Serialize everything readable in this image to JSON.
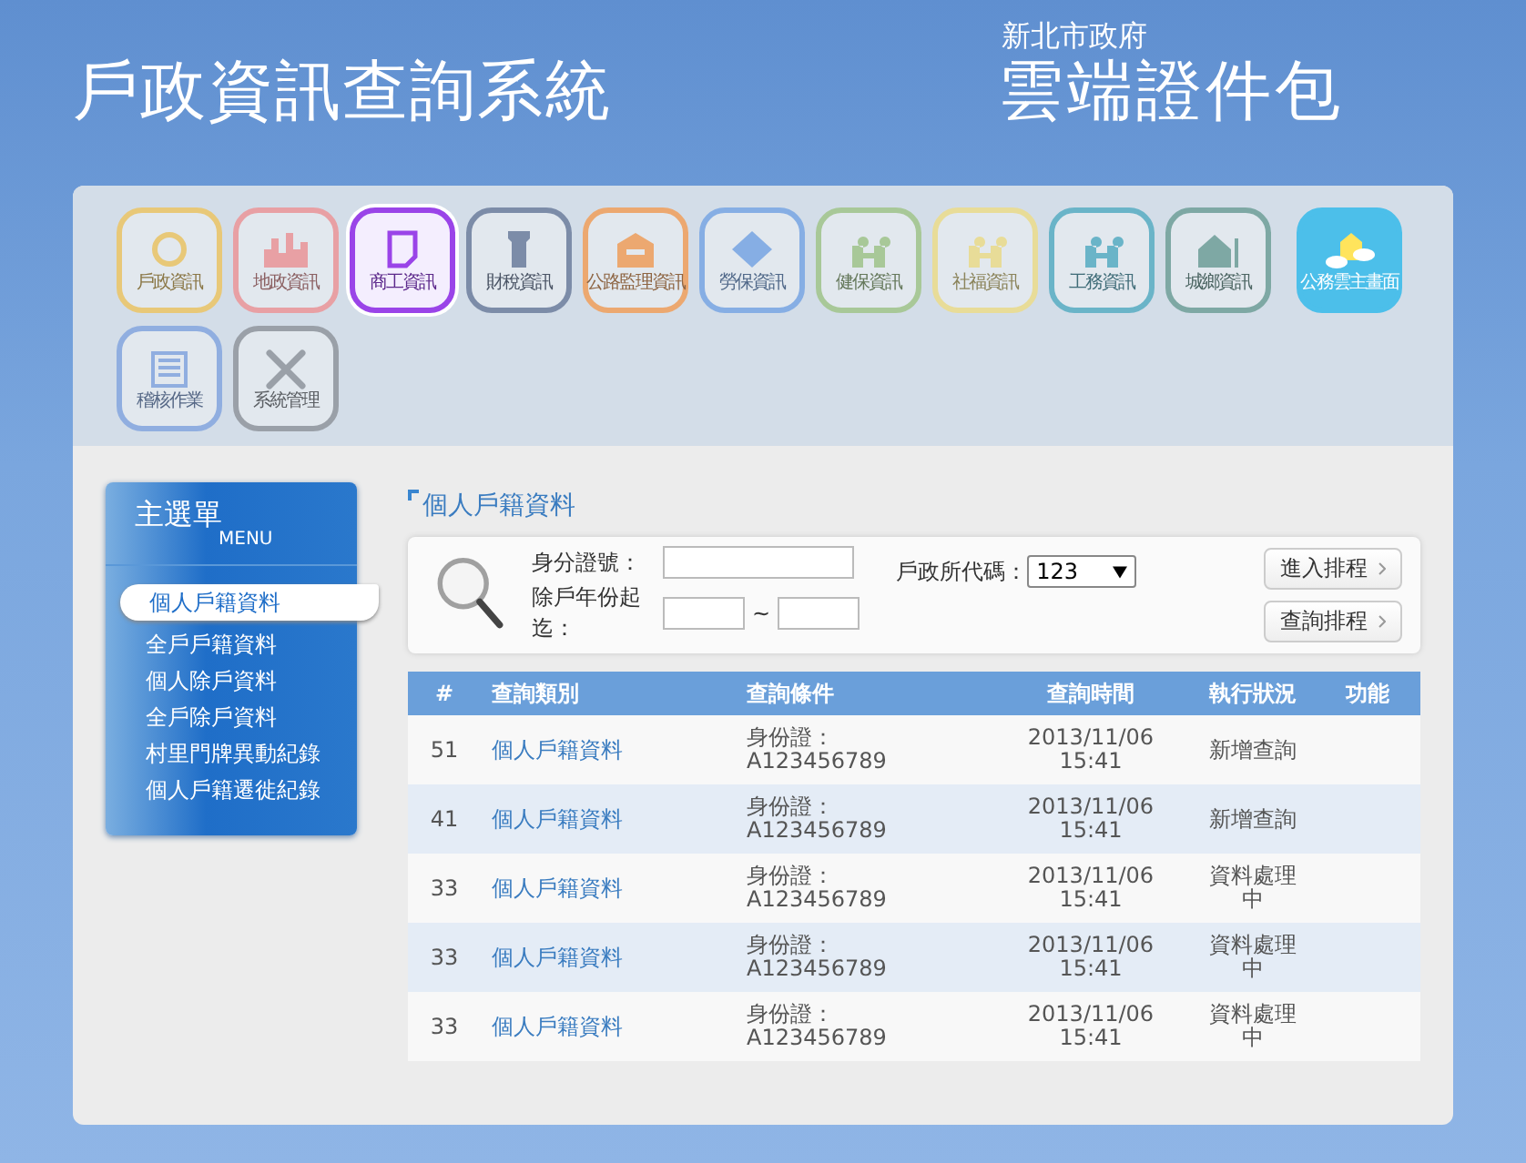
{
  "header": {
    "title": "戶政資訊查詢系統",
    "org": "新北市政府",
    "brand": "雲端證件包"
  },
  "modules": [
    {
      "kind": "module",
      "label": "戶政資訊",
      "color": "#e8c878",
      "selected": false
    },
    {
      "kind": "module",
      "label": "地政資訊",
      "color": "#e8a0a4",
      "selected": false
    },
    {
      "kind": "module",
      "label": "商工資訊",
      "color": "#9a44e8",
      "selected": true
    },
    {
      "kind": "module",
      "label": "財稅資訊",
      "color": "#7c8ca8",
      "selected": false
    },
    {
      "kind": "module",
      "label": "公路監理資訊",
      "color": "#eca870",
      "selected": false
    },
    {
      "kind": "module",
      "label": "勞保資訊",
      "color": "#86aee4",
      "selected": false
    },
    {
      "kind": "module",
      "label": "健保資訊",
      "color": "#a8c898",
      "selected": false
    },
    {
      "kind": "module",
      "label": "社福資訊",
      "color": "#e8dc98",
      "selected": false
    },
    {
      "kind": "module",
      "label": "工務資訊",
      "color": "#6ab4c8",
      "selected": false
    },
    {
      "kind": "module",
      "label": "城鄉資訊",
      "color": "#7ea8a4",
      "selected": false
    },
    {
      "kind": "home",
      "label": "公務雲主畫面",
      "color": "#4cbfea",
      "selected": false
    },
    {
      "kind": "module",
      "label": "稽核作業",
      "color": "#90aee0",
      "selected": false
    },
    {
      "kind": "module",
      "label": "系統管理",
      "color": "#9aa0a8",
      "selected": false
    }
  ],
  "sidebar": {
    "title": "主選單",
    "subtitle": "MENU",
    "items": [
      {
        "label": "個人戶籍資料",
        "selected": true
      },
      {
        "label": "全戶戶籍資料",
        "selected": false
      },
      {
        "label": "個人除戶資料",
        "selected": false
      },
      {
        "label": "全戶除戶資料",
        "selected": false
      },
      {
        "label": "村里門牌異動紀錄",
        "selected": false
      },
      {
        "label": "個人戶籍遷徙紀錄",
        "selected": false
      }
    ]
  },
  "page_title": "個人戶籍資料",
  "search": {
    "id_label": "身分證號：",
    "year_label": "除戶年份起迄：",
    "range_sep": "~",
    "office_label": "戶政所代碼：",
    "office_value": "123",
    "buttons": [
      "進入排程",
      "查詢排程"
    ]
  },
  "table": {
    "columns": [
      "#",
      "查詢類別",
      "查詢條件",
      "查詢時間",
      "執行狀況",
      "功能"
    ],
    "rows": [
      {
        "no": "51",
        "category": "個人戶籍資料",
        "condition": "身份證：\nA123456789",
        "time": "2013/11/06\n15:41",
        "status": "新增查詢"
      },
      {
        "no": "41",
        "category": "個人戶籍資料",
        "condition": "身份證：\nA123456789",
        "time": "2013/11/06\n15:41",
        "status": "新增查詢"
      },
      {
        "no": "33",
        "category": "個人戶籍資料",
        "condition": "身份證：\nA123456789",
        "time": "2013/11/06\n15:41",
        "status": "資料處理中"
      },
      {
        "no": "33",
        "category": "個人戶籍資料",
        "condition": "身份證：\nA123456789",
        "time": "2013/11/06\n15:41",
        "status": "資料處理中"
      },
      {
        "no": "33",
        "category": "個人戶籍資料",
        "condition": "身份證：\nA123456789",
        "time": "2013/11/06\n15:41",
        "status": "資料處理中"
      }
    ]
  }
}
